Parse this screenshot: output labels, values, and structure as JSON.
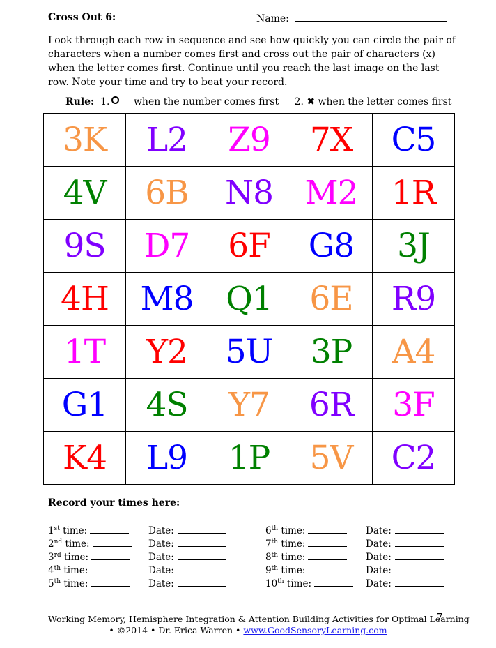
{
  "header": {
    "title": "Cross Out 6:",
    "name_label": "Name:"
  },
  "instructions": "Look through each row in sequence and see how quickly you can circle the pair of characters when a number comes first and cross out the pair of characters (x) when the letter comes first.  Continue until you reach the last image on the last row.  Note your time and try to beat your record.",
  "rule": {
    "label": "Rule:",
    "item1_num": "1.",
    "item1_icon": "circle-icon",
    "item1_text": "when the number comes first",
    "item2_num": "2.",
    "item2_icon": "heavy-x-icon",
    "item2_glyph": "✖",
    "item2_text": "when the letter comes first"
  },
  "colors": {
    "orange": "#f79646",
    "purple": "#8000ff",
    "magenta": "#ff00ff",
    "red": "#ff0000",
    "blue": "#0000ff",
    "green": "#008000"
  },
  "grid": [
    [
      {
        "text": "3K",
        "color": "orange"
      },
      {
        "text": "L2",
        "color": "purple"
      },
      {
        "text": "Z9",
        "color": "magenta"
      },
      {
        "text": "7X",
        "color": "red"
      },
      {
        "text": "C5",
        "color": "blue"
      }
    ],
    [
      {
        "text": "4V",
        "color": "green"
      },
      {
        "text": "6B",
        "color": "orange"
      },
      {
        "text": "N8",
        "color": "purple"
      },
      {
        "text": "M2",
        "color": "magenta"
      },
      {
        "text": "1R",
        "color": "red"
      }
    ],
    [
      {
        "text": "9S",
        "color": "purple"
      },
      {
        "text": "D7",
        "color": "magenta"
      },
      {
        "text": "6F",
        "color": "red"
      },
      {
        "text": "G8",
        "color": "blue"
      },
      {
        "text": "3J",
        "color": "green"
      }
    ],
    [
      {
        "text": "4H",
        "color": "red"
      },
      {
        "text": "M8",
        "color": "blue"
      },
      {
        "text": "Q1",
        "color": "green"
      },
      {
        "text": "6E",
        "color": "orange"
      },
      {
        "text": "R9",
        "color": "purple"
      }
    ],
    [
      {
        "text": "1T",
        "color": "magenta"
      },
      {
        "text": "Y2",
        "color": "red"
      },
      {
        "text": "5U",
        "color": "blue"
      },
      {
        "text": "3P",
        "color": "green"
      },
      {
        "text": "A4",
        "color": "orange"
      }
    ],
    [
      {
        "text": "G1",
        "color": "blue"
      },
      {
        "text": "4S",
        "color": "green"
      },
      {
        "text": "Y7",
        "color": "orange"
      },
      {
        "text": "6R",
        "color": "purple"
      },
      {
        "text": "3F",
        "color": "magenta"
      }
    ],
    [
      {
        "text": "K4",
        "color": "red"
      },
      {
        "text": "L9",
        "color": "blue"
      },
      {
        "text": "1P",
        "color": "green"
      },
      {
        "text": "5V",
        "color": "orange"
      },
      {
        "text": "C2",
        "color": "purple"
      }
    ]
  ],
  "record": {
    "title": "Record your times here:",
    "time_word": "time:",
    "date_label": "Date:",
    "left": [
      {
        "num": "1",
        "suffix": "st"
      },
      {
        "num": "2",
        "suffix": "nd"
      },
      {
        "num": "3",
        "suffix": "rd"
      },
      {
        "num": "4",
        "suffix": "th"
      },
      {
        "num": "5",
        "suffix": "th"
      }
    ],
    "right": [
      {
        "num": "6",
        "suffix": "th"
      },
      {
        "num": "7",
        "suffix": "th"
      },
      {
        "num": "8",
        "suffix": "th"
      },
      {
        "num": "9",
        "suffix": "th"
      },
      {
        "num": "10",
        "suffix": "th"
      }
    ]
  },
  "footer": {
    "line1": "Working Memory, Hemisphere Integration & Attention Building Activities for Optimal Learning",
    "page_number": "7",
    "line2_prefix": "• ©2014 • Dr. Erica Warren •",
    "link": "www.GoodSensoryLearning.com"
  }
}
